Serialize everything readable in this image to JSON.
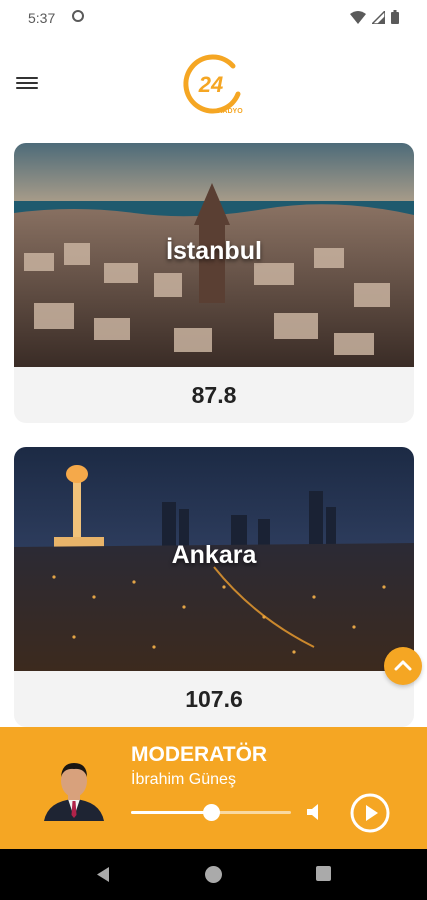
{
  "status_bar": {
    "time": "5:37",
    "icons": [
      "at-sign-icon",
      "wifi-icon",
      "signal-icon",
      "battery-icon"
    ]
  },
  "header": {
    "logo_number": "24",
    "logo_sub": "RADYO",
    "menu_icon": "hamburger-menu-icon"
  },
  "stations": [
    {
      "city": "İstanbul",
      "frequency": "87.8"
    },
    {
      "city": "Ankara",
      "frequency": "107.6"
    }
  ],
  "player": {
    "role": "MODERATÖR",
    "name": "İbrahim Güneş",
    "progress": 0.5,
    "volume_icon": "speaker-icon",
    "play_icon": "play-icon"
  },
  "nav_bar": {
    "icons": [
      "back-icon",
      "home-icon",
      "recents-icon"
    ]
  },
  "colors": {
    "accent": "#f5a623",
    "card_background": "#f3f3f3",
    "nav_background": "#000000"
  }
}
